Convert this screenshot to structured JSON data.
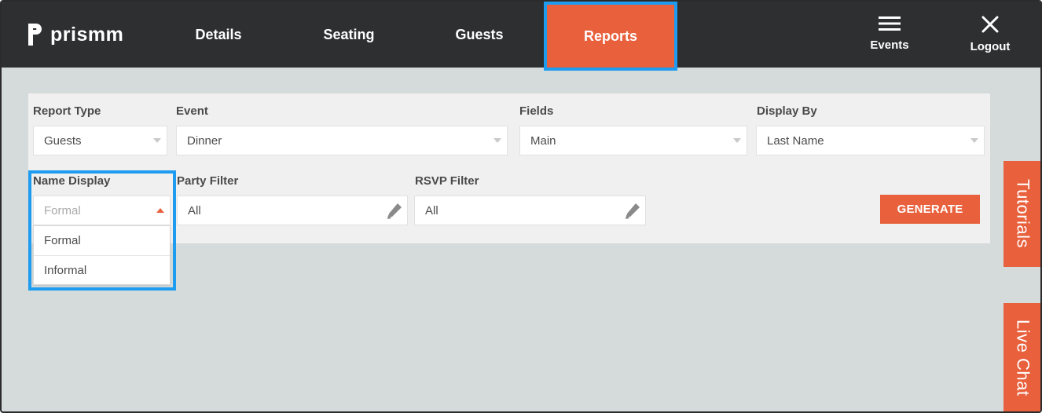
{
  "brand": {
    "name": "prismm"
  },
  "nav": {
    "details": "Details",
    "seating": "Seating",
    "guests": "Guests",
    "reports": "Reports"
  },
  "actions": {
    "events": "Events",
    "logout": "Logout"
  },
  "form": {
    "report_type": {
      "label": "Report Type",
      "value": "Guests"
    },
    "event": {
      "label": "Event",
      "value": "Dinner"
    },
    "fields": {
      "label": "Fields",
      "value": "Main"
    },
    "display_by": {
      "label": "Display By",
      "value": "Last Name"
    },
    "name_display": {
      "label": "Name Display",
      "placeholder": "Formal",
      "options": [
        "Formal",
        "Informal"
      ]
    },
    "party_filter": {
      "label": "Party Filter",
      "value": "All"
    },
    "rsvp_filter": {
      "label": "RSVP Filter",
      "value": "All"
    },
    "generate_label": "GENERATE"
  },
  "side_tabs": {
    "tutorials": "Tutorials",
    "live_chat": "Live Chat"
  },
  "colors": {
    "accent": "#e8603c",
    "topbar": "#2d2f31",
    "highlight": "#1e9cf0",
    "background": "#d5dadb"
  }
}
